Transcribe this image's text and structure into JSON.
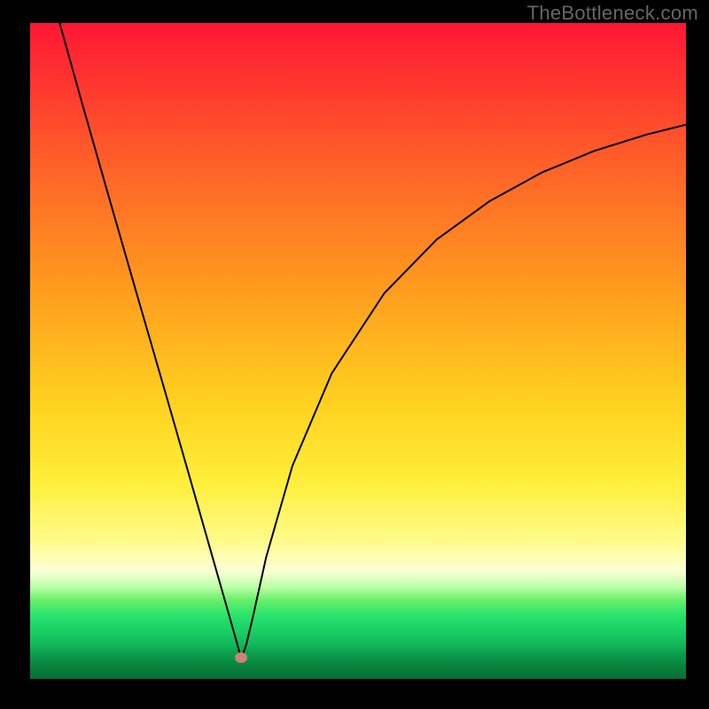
{
  "watermark": "TheBottleneck.com",
  "chart_data": {
    "type": "line",
    "title": "",
    "xlabel": "",
    "ylabel": "",
    "xlim": [
      0,
      100
    ],
    "ylim": [
      0,
      100
    ],
    "grid": false,
    "legend": false,
    "marker": {
      "x": 32.2,
      "y": 3.2,
      "color": "#cf8276"
    },
    "series": [
      {
        "name": "curve",
        "color": "#000000",
        "x": [
          4.5,
          8,
          12,
          16,
          20,
          24,
          28,
          30,
          31.5,
          32.2,
          33,
          34,
          36,
          40,
          46,
          54,
          62,
          70,
          78,
          86,
          94,
          100
        ],
        "y": [
          100,
          87.5,
          73.5,
          59.6,
          45.8,
          31.9,
          17.9,
          10.9,
          5.6,
          3.0,
          5.4,
          9.6,
          18.6,
          32.5,
          46.6,
          58.8,
          67.0,
          72.8,
          77.2,
          80.5,
          83.0,
          84.5
        ]
      }
    ],
    "background_gradient_stops": [
      {
        "pos": 0,
        "color": "#ff1735"
      },
      {
        "pos": 22,
        "color": "#ff6228"
      },
      {
        "pos": 40,
        "color": "#ff9a1f"
      },
      {
        "pos": 58,
        "color": "#ffd21f"
      },
      {
        "pos": 70,
        "color": "#ffee3a"
      },
      {
        "pos": 79,
        "color": "#fffb8a"
      },
      {
        "pos": 83.5,
        "color": "#fcffd6"
      },
      {
        "pos": 86,
        "color": "#bcffa8"
      },
      {
        "pos": 88,
        "color": "#68ef68"
      },
      {
        "pos": 90,
        "color": "#2fe66e"
      },
      {
        "pos": 92,
        "color": "#1fd96a"
      },
      {
        "pos": 94,
        "color": "#18ca63"
      },
      {
        "pos": 96,
        "color": "#0da450"
      },
      {
        "pos": 98,
        "color": "#08843e"
      },
      {
        "pos": 100,
        "color": "#056e34"
      }
    ]
  }
}
